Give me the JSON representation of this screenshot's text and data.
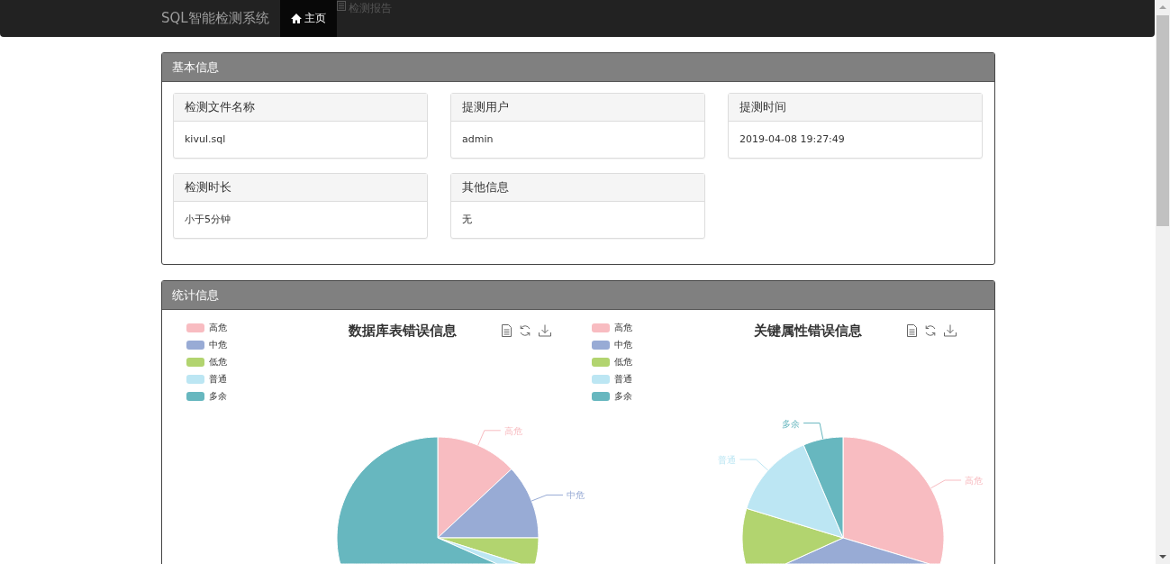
{
  "navbar": {
    "brand": "SQL智能检测系统",
    "items": [
      {
        "label": "主页",
        "selected": true
      },
      {
        "label": "检测报告",
        "selected": false
      }
    ]
  },
  "basic_info": {
    "title": "基本信息",
    "cards": [
      {
        "label": "检测文件名称",
        "value": "kivul.sql"
      },
      {
        "label": "提测用户",
        "value": "admin"
      },
      {
        "label": "提测时间",
        "value": "2019-04-08 19:27:49"
      },
      {
        "label": "检测时长",
        "value": "小于5分钟"
      },
      {
        "label": "其他信息",
        "value": "无"
      }
    ]
  },
  "statistics": {
    "title": "统计信息",
    "charts": [
      {
        "title": "数据库表错误信息",
        "legend": [
          {
            "label": "高危",
            "color": "#f8bcc1"
          },
          {
            "label": "中危",
            "color": "#98abd5"
          },
          {
            "label": "低危",
            "color": "#b2d46f"
          },
          {
            "label": "普通",
            "color": "#bce6f3"
          },
          {
            "label": "多余",
            "color": "#67b7bf"
          }
        ],
        "slice_labels": [
          "高危",
          "中危"
        ]
      },
      {
        "title": "关键属性错误信息",
        "legend": [
          {
            "label": "高危",
            "color": "#f8bcc1"
          },
          {
            "label": "中危",
            "color": "#98abd5"
          },
          {
            "label": "低危",
            "color": "#b2d46f"
          },
          {
            "label": "普通",
            "color": "#bce6f3"
          },
          {
            "label": "多余",
            "color": "#67b7bf"
          }
        ],
        "slice_labels": [
          "多余",
          "普通",
          "高危"
        ]
      }
    ]
  }
}
